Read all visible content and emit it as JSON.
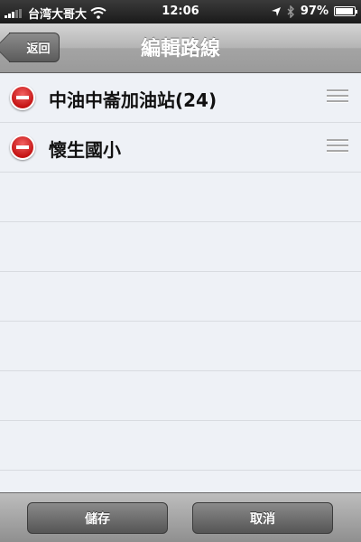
{
  "status_bar": {
    "carrier": "台湾大哥大",
    "time": "12:06",
    "battery": "97%",
    "battery_level": 0.97,
    "icons": [
      "wifi-icon",
      "location-arrow-icon",
      "bluetooth-icon",
      "battery-icon"
    ]
  },
  "nav": {
    "title": "編輯路線",
    "back_label": "返回"
  },
  "routes": [
    {
      "label": "中油中崙加油站(24)"
    },
    {
      "label": "懷生國小"
    }
  ],
  "toolbar": {
    "save_label": "儲存",
    "cancel_label": "取消"
  },
  "colors": {
    "delete_red": "#c51414",
    "list_background": "#eef1f6"
  }
}
